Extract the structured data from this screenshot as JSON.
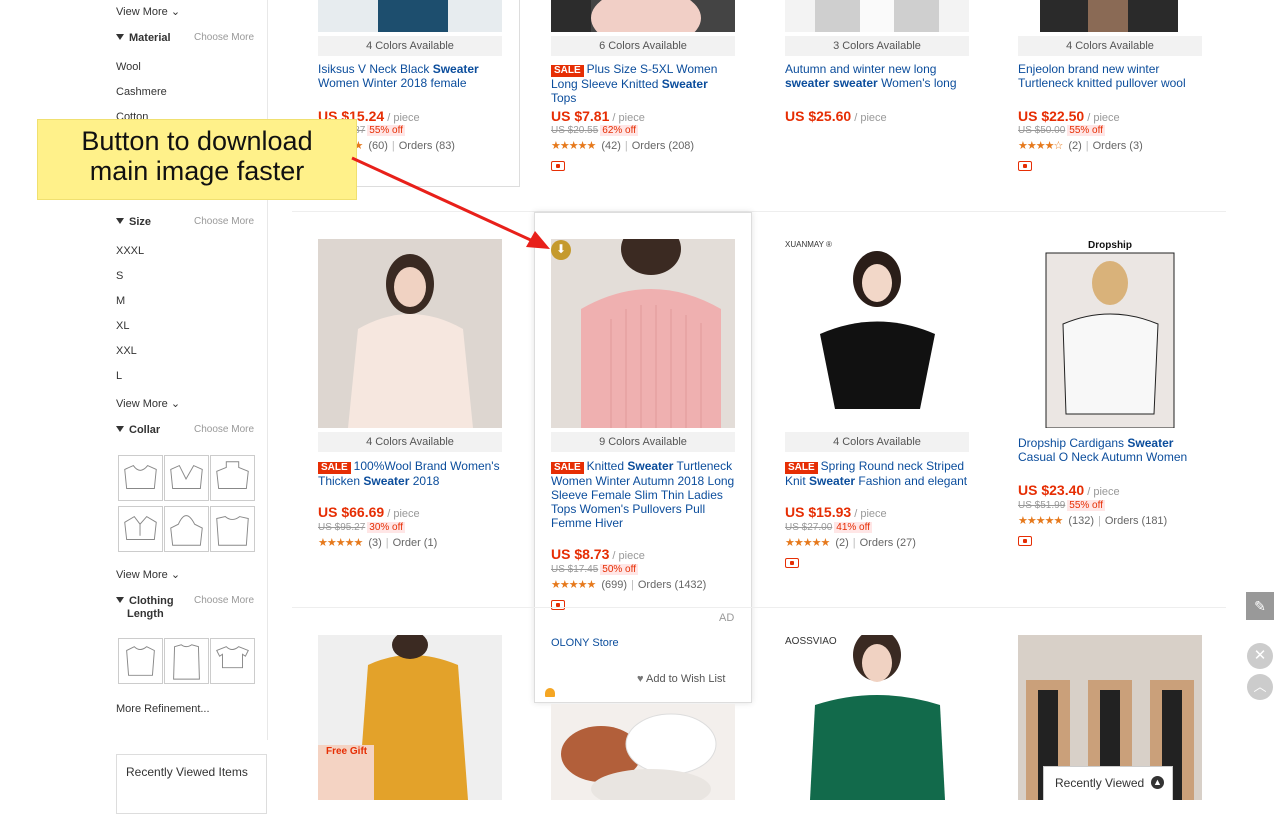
{
  "sidebar": {
    "view_more_top": "View More",
    "material": {
      "heading": "Material",
      "choose": "Choose More",
      "items": [
        "Wool",
        "Cashmere",
        "Cotton"
      ]
    },
    "size": {
      "heading": "Size",
      "choose": "Choose More",
      "items": [
        "XXXL",
        "S",
        "M",
        "XL",
        "XXL",
        "L"
      ],
      "view_more": "View More"
    },
    "collar": {
      "heading": "Collar",
      "choose": "Choose More",
      "view_more": "View More"
    },
    "clothing_length": {
      "heading_line1": "Clothing",
      "heading_line2": "Length",
      "choose": "Choose More"
    },
    "more_refinement": "More Refinement...",
    "recently_viewed_box": "Recently Viewed Items"
  },
  "callout": {
    "line1": "Button to download",
    "line2": "main image faster"
  },
  "row1": [
    {
      "colors": "4 Colors Available",
      "title_pre": "Isiksus V Neck Black ",
      "title_bold": "Sweater",
      "title_post": " Women Winter 2018 female",
      "price": "US $15.24",
      "unit": " / piece",
      "old": "US $33.87",
      "off": "55% off",
      "reviews": "(60)",
      "orders": "Orders (83)"
    },
    {
      "colors": "6 Colors Available",
      "sale": "SALE",
      "title_pre": "Plus Size S-5XL Women Long Sleeve Knitted ",
      "title_bold": "Sweater",
      "title_post": " Tops",
      "price": "US $7.81",
      "unit": " / piece",
      "old": "US $20.55",
      "off": "62% off",
      "reviews": "(42)",
      "orders": "Orders (208)"
    },
    {
      "colors": "3 Colors Available",
      "title_pre": "Autumn and winter new long ",
      "title_bold": "sweater sweater",
      "title_post": " Women's long",
      "price": "US $25.60",
      "unit": " / piece"
    },
    {
      "colors": "4 Colors Available",
      "title_pre": "Enjeolon brand new winter Turtleneck knitted pullover wool",
      "title_bold": "",
      "title_post": "",
      "price": "US $22.50",
      "unit": " / piece",
      "old": "US $50.00",
      "off": "55% off",
      "reviews": "(2)",
      "orders": "Orders (3)"
    }
  ],
  "row2": [
    {
      "colors": "4 Colors Available",
      "sale": "SALE",
      "title_pre": "100%Wool Brand Women's Thicken ",
      "title_bold": "Sweater",
      "title_post": " 2018",
      "price": "US $66.69",
      "unit": " / piece",
      "old": "US $95.27",
      "off": "30% off",
      "reviews": "(3)",
      "orders": "Order (1)"
    },
    {
      "colors": "9 Colors Available",
      "sale": "SALE",
      "title_pre": "Knitted ",
      "title_bold": "Sweater",
      "title_post": " Turtleneck Women Winter Autumn 2018 Long Sleeve Female Slim Thin Ladies Tops Women's Pullovers Pull Femme Hiver",
      "price": "US $8.73",
      "unit": " / piece",
      "old": "US $17.45",
      "off": "50% off",
      "reviews": "(699)",
      "orders": "Orders (1432)",
      "ad": "AD",
      "store": "OLONY Store",
      "wish": "Add to Wish List"
    },
    {
      "colors": "4 Colors Available",
      "brand": "XUANMAY ®",
      "sale": "SALE",
      "title_pre": "Spring Round neck Striped Knit ",
      "title_bold": "Sweater",
      "title_post": " Fashion and elegant",
      "price": "US $15.93",
      "unit": " / piece",
      "old": "US $27.00",
      "off": "41% off",
      "reviews": "(2)",
      "orders": "Orders (27)"
    },
    {
      "brand": "Dropship",
      "title_pre": "Dropship Cardigans ",
      "title_bold": "Sweater",
      "title_post": " Casual O Neck Autumn Women",
      "price": "US $23.40",
      "unit": " / piece",
      "old": "US $51.99",
      "off": "55% off",
      "reviews": "(132)",
      "orders": "Orders (181)"
    }
  ],
  "row3": {
    "free_gift": "Free Gift",
    "brand": "AOSSVIAO"
  },
  "recently_viewed_bar": "Recently Viewed",
  "colors": {
    "accent": "#e62e04",
    "link": "#0b4d9c",
    "star": "#e6791c",
    "callout_bg": "#fff18a",
    "arrow": "#e8201a"
  }
}
